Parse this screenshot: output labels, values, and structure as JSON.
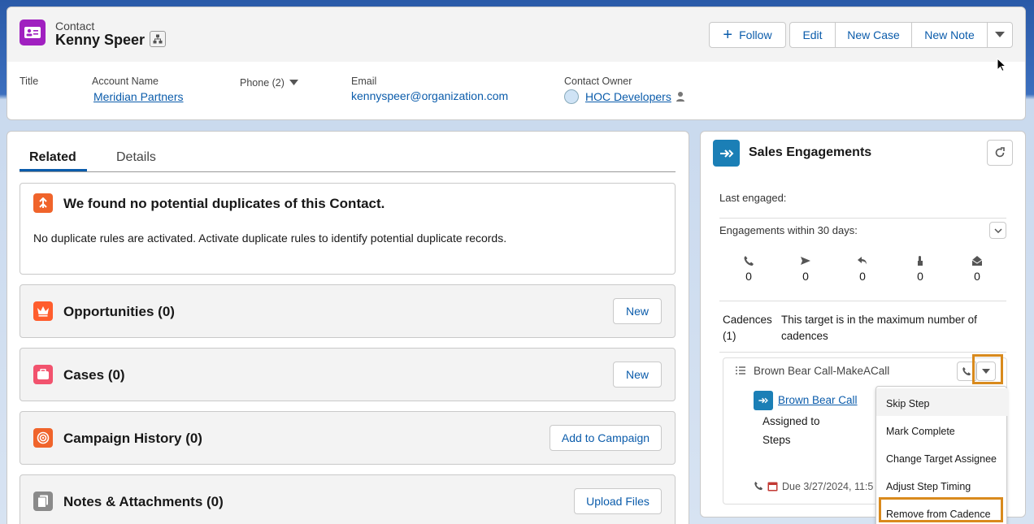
{
  "header": {
    "object_type": "Contact",
    "name": "Kenny Speer",
    "actions": {
      "follow": "Follow",
      "edit": "Edit",
      "new_case": "New Case",
      "new_note": "New Note"
    },
    "fields": {
      "title_label": "Title",
      "account_label": "Account Name",
      "account_value": "Meridian Partners",
      "phone_label": "Phone (2)",
      "email_label": "Email",
      "email_value": "kennyspeer@organization.com",
      "owner_label": "Contact Owner",
      "owner_value": "HOC Developers"
    }
  },
  "tabs": {
    "related": "Related",
    "details": "Details"
  },
  "duplicates": {
    "title": "We found no potential duplicates of this Contact.",
    "message": "No duplicate rules are activated. Activate duplicate rules to identify potential duplicate records."
  },
  "sections": [
    {
      "title": "Opportunities (0)",
      "action": "New",
      "color": "#ff5d2d"
    },
    {
      "title": "Cases (0)",
      "action": "New",
      "color": "#f2536e"
    },
    {
      "title": "Campaign History (0)",
      "action": "Add to Campaign",
      "color": "#f0642b"
    },
    {
      "title": "Notes & Attachments (0)",
      "action": "Upload Files",
      "color": "#8a8a8a"
    }
  ],
  "engagement": {
    "title": "Sales Engagements",
    "last_engaged": "Last engaged:",
    "within_label": "Engagements within 30 days:",
    "stats": [
      {
        "icon": "phone-icon",
        "value": "0"
      },
      {
        "icon": "send-icon",
        "value": "0"
      },
      {
        "icon": "reply-icon",
        "value": "0"
      },
      {
        "icon": "click-icon",
        "value": "0"
      },
      {
        "icon": "open-icon",
        "value": "0"
      }
    ],
    "cadences_label": "Cadences (1)",
    "cadences_note": "This target is in the maximum number of cadences",
    "cadence_name": "Brown Bear Call-MakeACall",
    "step_link": "Brown Bear Call",
    "assigned_to": "Assigned to",
    "steps": "Steps",
    "due": "Due 3/27/2024, 11:5"
  },
  "menu": {
    "items": [
      "Skip Step",
      "Mark Complete",
      "Change Target Assignee",
      "Adjust Step Timing",
      "Remove from Cadence"
    ]
  },
  "colors": {
    "accent": "#0b5cab",
    "contact_icon": "#a020c0",
    "highlight": "#d98a1d",
    "engagement_icon": "#1b7fb6"
  }
}
